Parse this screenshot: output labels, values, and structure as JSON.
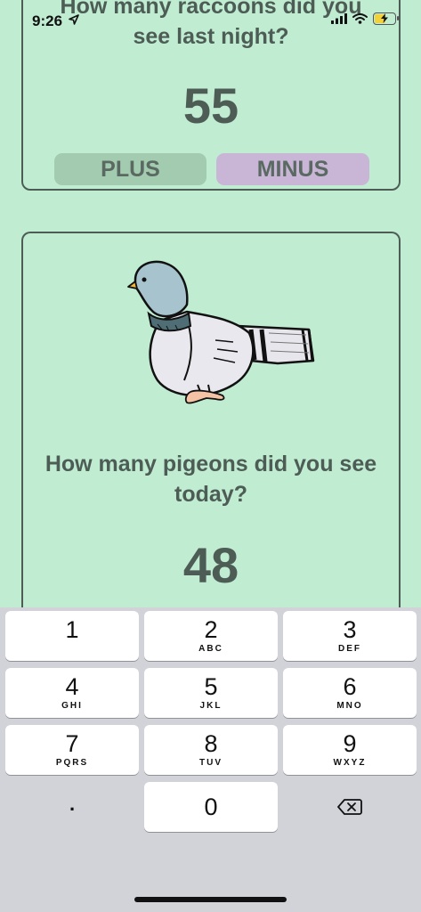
{
  "status_bar": {
    "time": "9:26",
    "battery_level": 0.5
  },
  "raccoon_card": {
    "question": "How many raccoons did you see last night?",
    "count": "55",
    "plus_label": "PLUS",
    "minus_label": "MINUS"
  },
  "pigeon_card": {
    "question": "How many pigeons did you see today?",
    "count": "48"
  },
  "keypad": {
    "keys": [
      {
        "digit": "1",
        "letters": ""
      },
      {
        "digit": "2",
        "letters": "ABC"
      },
      {
        "digit": "3",
        "letters": "DEF"
      },
      {
        "digit": "4",
        "letters": "GHI"
      },
      {
        "digit": "5",
        "letters": "JKL"
      },
      {
        "digit": "6",
        "letters": "MNO"
      },
      {
        "digit": "7",
        "letters": "PQRS"
      },
      {
        "digit": "8",
        "letters": "TUV"
      },
      {
        "digit": "9",
        "letters": "WXYZ"
      },
      {
        "digit": "0",
        "letters": ""
      }
    ],
    "decimal_label": "."
  },
  "colors": {
    "background": "#c0ecd2",
    "text": "#4d5d56",
    "plus_button": "#a3cbb0",
    "minus_button": "#c9b5d6",
    "keypad_background": "#d1d3d8"
  },
  "icons": [
    "navigation-arrow-icon",
    "signal-icon",
    "wifi-icon",
    "battery-charging-icon",
    "pigeon-illustration",
    "backspace-icon"
  ]
}
